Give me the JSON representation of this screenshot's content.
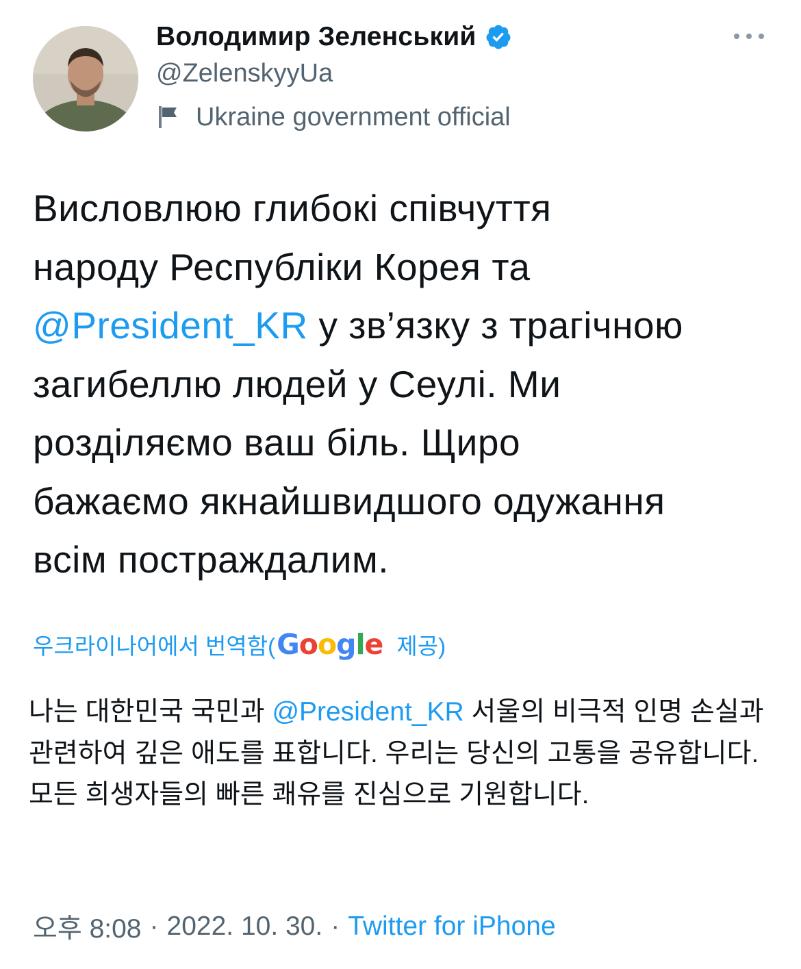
{
  "author": {
    "display_name": "Володимир Зеленський",
    "handle": "@ZelenskyyUa",
    "label": "Ukraine government official",
    "verified": true,
    "avatar_icon": "profile-photo"
  },
  "actions": {
    "more_icon": "more-horizontal-icon"
  },
  "tweet": {
    "line1": "Висловлюю глибокі співчуття",
    "line2": "народу Республіки Корея та",
    "mention": "@President_KR",
    "line3_rest": " у зв’язку з трагічною",
    "line4": "загибеллю людей у Сеулі. Ми",
    "line5": "розділяємо ваш біль. Щиро",
    "line6": "бажаємо якнайшвидшого одужання",
    "line7": "всім постраждалим."
  },
  "translation": {
    "label": "우크라이나어에서 번역함(",
    "provider_letters": [
      "G",
      "o",
      "o",
      "g",
      "l",
      "e"
    ],
    "provided_label": "제공)",
    "text_before": "나는 대한민국 국민과 ",
    "mention": "@President_KR",
    "text_after": " 서울의 비극적 인명 손실과 관련하여 깊은 애도를 표합니다. 우리는 당신의 고통을 공유합니다. 모든 희생자들의 빠른 쾌유를 진심으로 기원합니다."
  },
  "meta": {
    "time": "오후 8:08",
    "separator": "·",
    "date": "2022. 10. 30.",
    "source": "Twitter for iPhone"
  },
  "colors": {
    "link": "#1d9bf0",
    "secondary_text": "#536471",
    "primary_text": "#0f1419",
    "verified_badge": "#1d9bf0"
  }
}
